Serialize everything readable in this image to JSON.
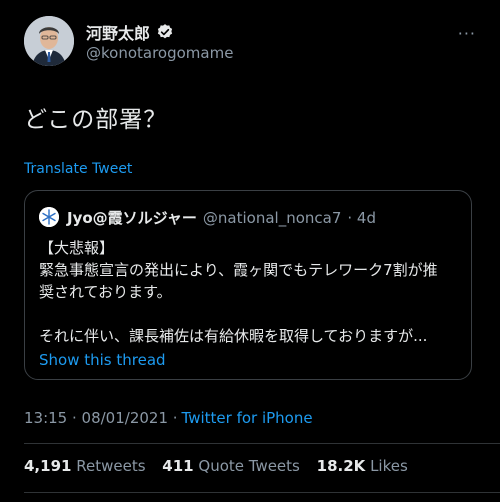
{
  "author": {
    "display_name": "河野太郎",
    "handle": "@konotarogomame",
    "verified": true,
    "avatar_icon": "user-photo"
  },
  "more_menu_label": "···",
  "tweet": {
    "text": "どこの部署？",
    "translate_label": "Translate Tweet"
  },
  "quoted": {
    "name": "Jyo@霞ソルジャー",
    "handle": "@national_nonca7",
    "time": "· 4d",
    "lines": [
      "【大悲報】",
      "緊急事態宣言の発出により、霞ヶ関でもテレワーク7割が推",
      "奨されております。",
      "",
      "それに伴い、課長補佐は有給休暇を取得しておりますが..."
    ],
    "show_thread_label": "Show this thread"
  },
  "timestamp": {
    "time": "13:15 · 08/01/2021 ·",
    "source": "Twitter for iPhone"
  },
  "stats": {
    "retweets_count": "4,191",
    "retweets_label": "Retweets",
    "quotes_count": "411",
    "quotes_label": "Quote Tweets",
    "likes_count": "18.2K",
    "likes_label": "Likes"
  },
  "colors": {
    "background": "#000000",
    "text": "#e7e9ea",
    "muted": "#8b98a5",
    "link": "#1d9bf0",
    "border": "#2f3336"
  }
}
